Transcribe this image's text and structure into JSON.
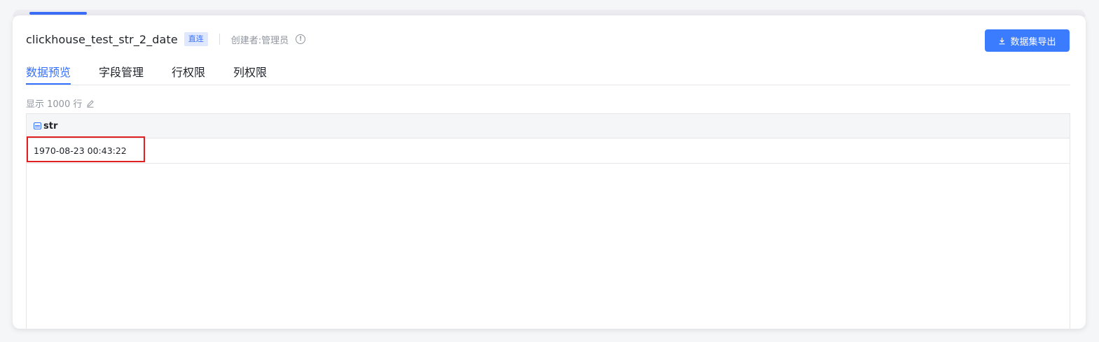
{
  "dataset": {
    "title": "clickhouse_test_str_2_date",
    "tag": "直连",
    "creator": "创建者:管理员",
    "info_icon": "info-circle-icon"
  },
  "toolbar": {
    "export_label": "数据集导出",
    "export_icon": "download-icon"
  },
  "tabs": [
    {
      "label": "数据预览",
      "active": true
    },
    {
      "label": "字段管理",
      "active": false
    },
    {
      "label": "行权限",
      "active": false
    },
    {
      "label": "列权限",
      "active": false
    }
  ],
  "preview": {
    "rows_label": "显示 1000 行",
    "edit_icon": "pencil-icon"
  },
  "table": {
    "columns": [
      {
        "name": "str",
        "type_icon": "string-type-icon"
      }
    ],
    "rows": [
      [
        "1970-08-23 00:43:22"
      ]
    ]
  },
  "colors": {
    "accent": "#3370ff",
    "button": "#3b7cff",
    "highlight": "#e02020"
  }
}
